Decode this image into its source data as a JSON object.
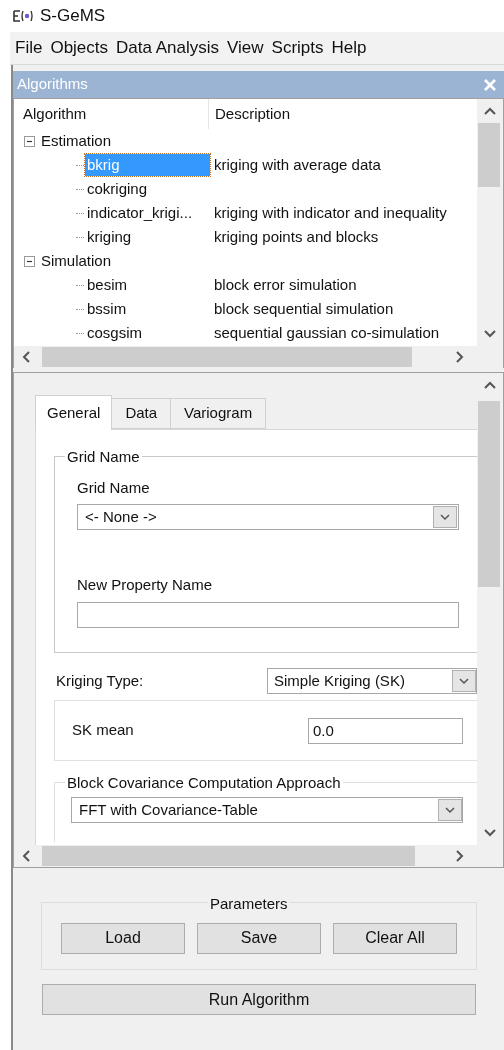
{
  "app": {
    "title": "S-GeMS"
  },
  "menu": [
    "File",
    "Objects",
    "Data Analysis",
    "View",
    "Scripts",
    "Help"
  ],
  "algorithms_panel": {
    "title": "Algorithms",
    "columns": [
      "Algorithm",
      "Description"
    ],
    "tree": [
      {
        "label": "Estimation",
        "expanded": true,
        "children": [
          {
            "name": "bkrig",
            "description": "kriging with average data",
            "selected": true
          },
          {
            "name": "cokriging",
            "selected": false
          },
          {
            "name": "indicator_krigi...",
            "description": "kriging with indicator and inequality",
            "selected": false
          },
          {
            "name": "kriging",
            "description": "kriging points and blocks",
            "selected": false
          }
        ]
      },
      {
        "label": "Simulation",
        "expanded": true,
        "children": [
          {
            "name": "besim",
            "description": "block error simulation",
            "selected": false
          },
          {
            "name": "bssim",
            "description": "block sequential simulation",
            "selected": false
          },
          {
            "name": "cosgsim",
            "description": "sequential gaussian co-simulation",
            "selected": false
          }
        ]
      }
    ]
  },
  "settings_panel": {
    "tabs": [
      {
        "label": "General",
        "selected": true
      },
      {
        "label": "Data",
        "selected": false
      },
      {
        "label": "Variogram",
        "selected": false
      }
    ],
    "grid_group": {
      "title": "Grid Name",
      "grid_label": "Grid Name",
      "grid_value": "<- None ->",
      "property_label": "New Property Name"
    },
    "kriging_type": {
      "label": "Kriging Type:",
      "value": "Simple Kriging (SK)"
    },
    "sk_mean": {
      "label": "SK mean",
      "value": "0.0"
    },
    "block_group": {
      "title": "Block Covariance Computation Approach",
      "value": "FFT with Covariance-Table"
    }
  },
  "parameters": {
    "title": "Parameters",
    "buttons": [
      "Load",
      "Save",
      "Clear All"
    ]
  },
  "run_button": "Run Algorithm"
}
